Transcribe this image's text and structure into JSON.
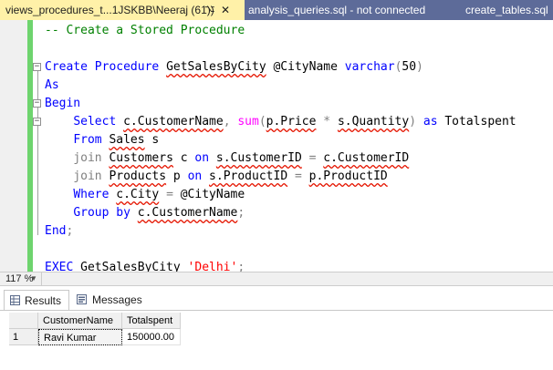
{
  "tabs": [
    {
      "label": "views_procedures_t...1JSKBB\\Neeraj (61))",
      "active": true
    },
    {
      "label": "analysis_queries.sql - not connected",
      "active": false
    },
    {
      "label": "create_tables.sql",
      "active": false
    }
  ],
  "tab_icons": {
    "pin": "pin-icon",
    "close": "close-icon"
  },
  "editor": {
    "lines": [
      {
        "tokens": [
          {
            "t": "-- Create a Stored Procedure",
            "c": "cm"
          }
        ]
      },
      {
        "tokens": []
      },
      {
        "fold": true,
        "tokens": [
          {
            "t": "Create",
            "c": "kw"
          },
          {
            "t": " ",
            "c": "id"
          },
          {
            "t": "Procedure",
            "c": "kw"
          },
          {
            "t": " ",
            "c": "id"
          },
          {
            "t": "GetSalesByCity",
            "c": "id",
            "sq": true
          },
          {
            "t": " ",
            "c": "id"
          },
          {
            "t": "@CityName",
            "c": "id"
          },
          {
            "t": " ",
            "c": "id"
          },
          {
            "t": "varchar",
            "c": "kw"
          },
          {
            "t": "(",
            "c": "op"
          },
          {
            "t": "50",
            "c": "id"
          },
          {
            "t": ")",
            "c": "op"
          }
        ]
      },
      {
        "tokens": [
          {
            "t": "As",
            "c": "kw"
          }
        ]
      },
      {
        "fold": true,
        "tokens": [
          {
            "t": "Begin",
            "c": "kw"
          }
        ]
      },
      {
        "fold": true,
        "tokens": [
          {
            "t": "    ",
            "c": "id"
          },
          {
            "t": "Select",
            "c": "kw"
          },
          {
            "t": " ",
            "c": "id"
          },
          {
            "t": "c.CustomerName",
            "c": "id",
            "sq": true
          },
          {
            "t": ", ",
            "c": "op"
          },
          {
            "t": "sum",
            "c": "fn"
          },
          {
            "t": "(",
            "c": "op"
          },
          {
            "t": "p.Price",
            "c": "id",
            "sq": true
          },
          {
            "t": " * ",
            "c": "op"
          },
          {
            "t": "s.Quantity",
            "c": "id",
            "sq": true
          },
          {
            "t": ") ",
            "c": "op"
          },
          {
            "t": "as",
            "c": "kw"
          },
          {
            "t": " ",
            "c": "id"
          },
          {
            "t": "Totalspent",
            "c": "id"
          }
        ]
      },
      {
        "tokens": [
          {
            "t": "    ",
            "c": "id"
          },
          {
            "t": "From",
            "c": "kw"
          },
          {
            "t": " ",
            "c": "id"
          },
          {
            "t": "Sales",
            "c": "id",
            "sq": true
          },
          {
            "t": " s",
            "c": "id"
          }
        ]
      },
      {
        "tokens": [
          {
            "t": "    ",
            "c": "id"
          },
          {
            "t": "join",
            "c": "op"
          },
          {
            "t": " ",
            "c": "id"
          },
          {
            "t": "Customers",
            "c": "id",
            "sq": true
          },
          {
            "t": " c ",
            "c": "id"
          },
          {
            "t": "on",
            "c": "kw"
          },
          {
            "t": " ",
            "c": "id"
          },
          {
            "t": "s.CustomerID",
            "c": "id",
            "sq": true
          },
          {
            "t": " = ",
            "c": "op"
          },
          {
            "t": "c.CustomerID",
            "c": "id",
            "sq": true
          }
        ]
      },
      {
        "tokens": [
          {
            "t": "    ",
            "c": "id"
          },
          {
            "t": "join",
            "c": "op"
          },
          {
            "t": " ",
            "c": "id"
          },
          {
            "t": "Products",
            "c": "id",
            "sq": true
          },
          {
            "t": " p ",
            "c": "id"
          },
          {
            "t": "on",
            "c": "kw"
          },
          {
            "t": " ",
            "c": "id"
          },
          {
            "t": "s.ProductID",
            "c": "id",
            "sq": true
          },
          {
            "t": " = ",
            "c": "op"
          },
          {
            "t": "p.ProductID",
            "c": "id",
            "sq": true
          }
        ]
      },
      {
        "tokens": [
          {
            "t": "    ",
            "c": "id"
          },
          {
            "t": "Where",
            "c": "kw"
          },
          {
            "t": " ",
            "c": "id"
          },
          {
            "t": "c.City",
            "c": "id",
            "sq": true
          },
          {
            "t": " = ",
            "c": "op"
          },
          {
            "t": "@CityName",
            "c": "id"
          }
        ]
      },
      {
        "tokens": [
          {
            "t": "    ",
            "c": "id"
          },
          {
            "t": "Group by",
            "c": "kw"
          },
          {
            "t": " ",
            "c": "id"
          },
          {
            "t": "c.CustomerName",
            "c": "id",
            "sq": true
          },
          {
            "t": ";",
            "c": "op"
          }
        ]
      },
      {
        "tokens": [
          {
            "t": "End",
            "c": "kw"
          },
          {
            "t": ";",
            "c": "op"
          }
        ]
      },
      {
        "tokens": []
      },
      {
        "tokens": [
          {
            "t": "EXEC",
            "c": "kw"
          },
          {
            "t": " ",
            "c": "id"
          },
          {
            "t": "GetSalesByCity",
            "c": "id",
            "sq": true
          },
          {
            "t": " ",
            "c": "id"
          },
          {
            "t": "'Delhi'",
            "c": "st"
          },
          {
            "t": ";",
            "c": "op"
          }
        ]
      }
    ]
  },
  "zoom": {
    "level": "117 %"
  },
  "results": {
    "tabs": [
      {
        "label": "Results",
        "icon": "grid-icon"
      },
      {
        "label": "Messages",
        "icon": "messages-icon"
      }
    ],
    "columns": [
      "CustomerName",
      "Totalspent"
    ],
    "rows": [
      {
        "num": "1",
        "cells": [
          "Ravi Kumar",
          "150000.00"
        ]
      }
    ]
  }
}
